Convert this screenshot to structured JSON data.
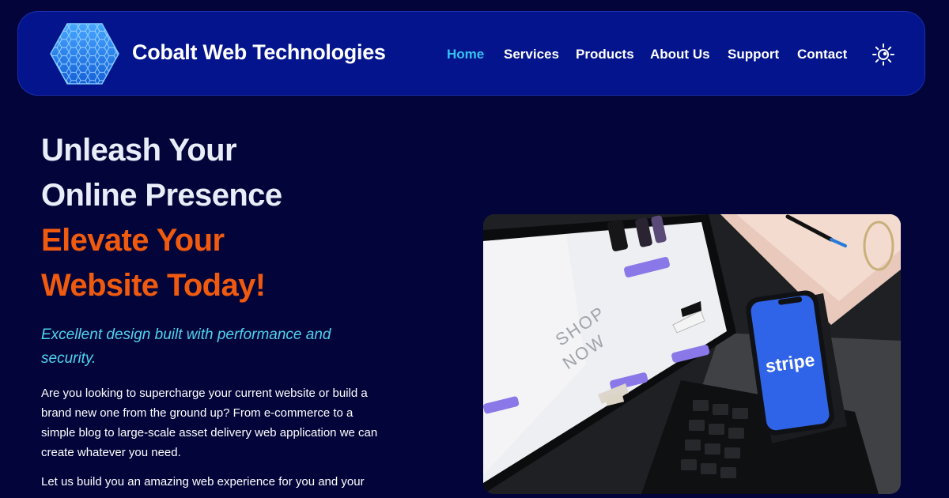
{
  "header": {
    "brand": "Cobalt Web Technologies",
    "logo_icon": "hexagon-honeycomb-logo",
    "nav": [
      {
        "label": "Home",
        "active": true
      },
      {
        "label": "Services",
        "active": false
      },
      {
        "label": "Products",
        "active": false
      },
      {
        "label": "About Us",
        "active": false
      },
      {
        "label": "Support",
        "active": false
      },
      {
        "label": "Contact",
        "active": false
      }
    ],
    "theme_toggle_icon": "sun-icon"
  },
  "hero": {
    "headline_line1": "Unleash Your",
    "headline_line2": "Online Presence",
    "highlight_line1": "Elevate Your",
    "highlight_line2": "Website Today!",
    "tagline": "Excellent design built with performance and security.",
    "paragraph1": "Are you looking to supercharge your current website or build a brand new one from the ground up? From e-commerce to a simple blog to large-scale asset delivery web application we can create whatever you need.",
    "paragraph2": "Let us build you an amazing web experience for you and your",
    "image": {
      "screen_text_line1": "SHOP",
      "screen_text_line2": "NOW",
      "phone_text": "stripe"
    }
  },
  "colors": {
    "page_background": "#03053a",
    "nav_background": "#03148c",
    "active_nav": "#34c3ef",
    "highlight_orange": "#f05a0f",
    "tagline_cyan": "#4fd2ee",
    "stripe_blue": "#2f64e8"
  }
}
